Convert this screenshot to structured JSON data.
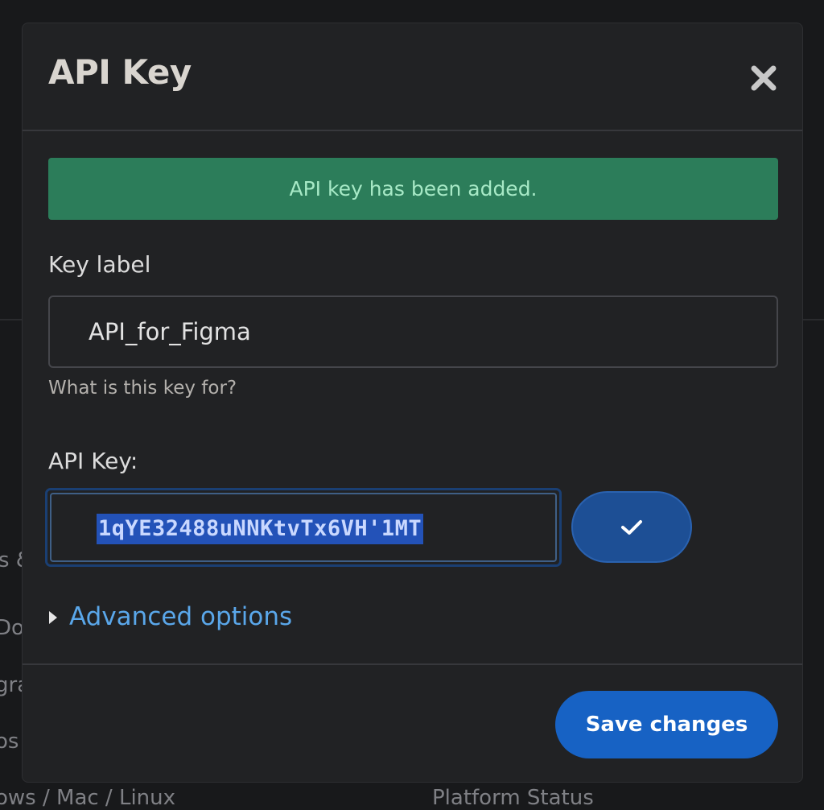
{
  "background": {
    "left_fragments": [
      "s &",
      "Doc",
      "gra",
      "os"
    ],
    "bottom_left": "ows / Mac / Linux",
    "bottom_center": "Platform Status"
  },
  "modal": {
    "title": "API Key",
    "close_icon": "close-icon",
    "alert": {
      "text": "API key has been added.",
      "color": "#2c7d5a"
    },
    "key_label": {
      "label": "Key label",
      "value": "API_for_Figma",
      "help": "What is this key for?"
    },
    "api_key": {
      "label": "API Key:",
      "value": "1qYE32488uNNKtvTx6VH'1MT",
      "confirm_icon": "check-icon"
    },
    "advanced_options": {
      "label": "Advanced options",
      "icon": "triangle-right-icon"
    },
    "footer": {
      "save_label": "Save changes"
    }
  },
  "colors": {
    "accent": "#1762c4",
    "link": "#5aa7ea",
    "success_bg": "#2c7d5a",
    "success_text": "#a7e9c6"
  }
}
